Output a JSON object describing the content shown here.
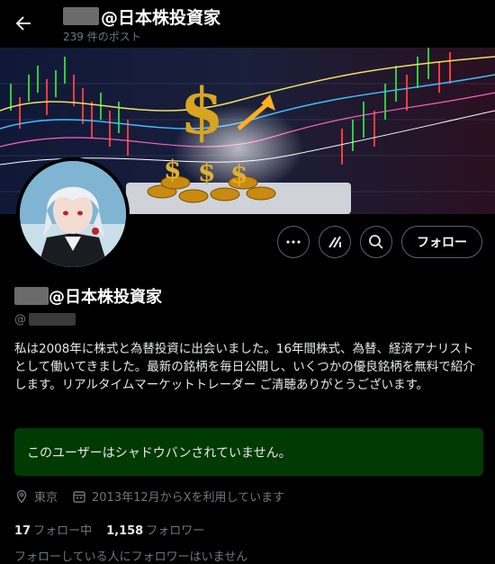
{
  "header": {
    "title": "@日本株投資家",
    "post_count": "239 件のポスト"
  },
  "actions": {
    "follow_label": "フォロー"
  },
  "profile": {
    "display_name": "@日本株投資家",
    "handle_prefix": "@",
    "bio": "私は2008年に株式と為替投資に出会いました。16年間株式、為替、経済アナリストとして働いてきました。最新の銘柄を毎日公開し、いくつかの優良銘柄を無料で紹介します。リアルタイムマーケットトレーダー ご清聴ありがとうございます。"
  },
  "shadowban": {
    "message": "このユーザーはシャドウバンされていません。"
  },
  "meta": {
    "location": "東京",
    "joined": "2013年12月からXを利用しています"
  },
  "stats": {
    "following_count": "17",
    "following_label": "フォロー中",
    "followers_count": "1,158",
    "followers_label": "フォロワー"
  },
  "note": "フォローしている人にフォロワーはいません",
  "colors": {
    "background": "#000000",
    "muted_text": "#71767b",
    "shadowban_bg": "#013a02",
    "border": "#536471"
  }
}
